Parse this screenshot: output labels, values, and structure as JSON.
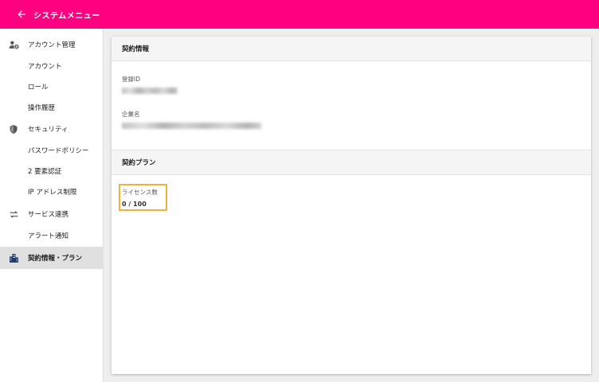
{
  "appbar": {
    "title": "システムメニュー"
  },
  "sidebar": {
    "items": [
      {
        "label": "アカウント管理",
        "icon": "user-settings-icon"
      },
      {
        "label": "アカウント"
      },
      {
        "label": "ロール"
      },
      {
        "label": "操作履歴"
      },
      {
        "label": "セキュリティ",
        "icon": "shield-icon"
      },
      {
        "label": "パスワードポリシー"
      },
      {
        "label": "2 要素認証"
      },
      {
        "label": "IP アドレス制限"
      },
      {
        "label": "サービス連携",
        "icon": "swap-arrows-icon"
      },
      {
        "label": "アラート通知"
      },
      {
        "label": "契約情報・プラン",
        "icon": "building-icon",
        "active": true
      }
    ]
  },
  "contract": {
    "title": "契約情報",
    "login_id_label": "登録ID",
    "company_label": "企業名"
  },
  "plan": {
    "title": "契約プラン",
    "license_label": "ライセンス数",
    "license_value": "0 / 100"
  },
  "colors": {
    "accent": "#ff0080",
    "highlight": "#f0b040"
  }
}
